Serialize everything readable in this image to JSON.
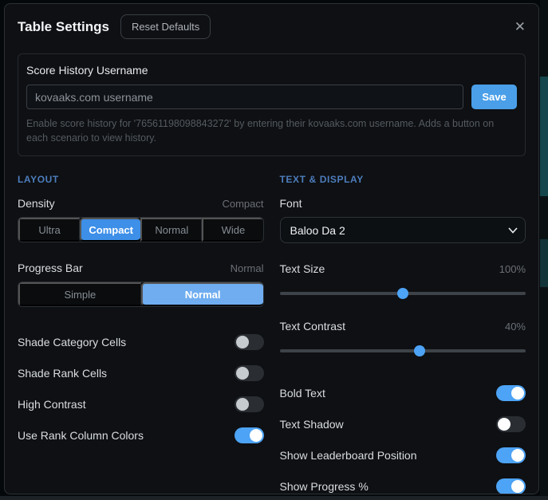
{
  "modal": {
    "title": "Table Settings",
    "reset_button_label": "Reset Defaults",
    "close_icon": "✕"
  },
  "score_history": {
    "label": "Score History Username",
    "input_value": "",
    "input_placeholder": "kovaaks.com username",
    "save_button_label": "Save",
    "help_text": "Enable score history for '76561198098843272' by entering their kovaaks.com username. Adds a button on each scenario to view history."
  },
  "layout_section": {
    "header": "LAYOUT",
    "density": {
      "label": "Density",
      "value": "Compact",
      "selected": "Compact",
      "options": [
        "Ultra",
        "Compact",
        "Normal",
        "Wide"
      ]
    },
    "progress_bar": {
      "label": "Progress Bar",
      "value": "Normal",
      "selected": "Normal",
      "options": [
        "Simple",
        "Normal"
      ]
    },
    "toggles": [
      {
        "label": "Shade Category Cells",
        "state": false
      },
      {
        "label": "Shade Rank Cells",
        "state": false
      },
      {
        "label": "High Contrast",
        "state": false
      },
      {
        "label": "Use Rank Column Colors",
        "state": true
      }
    ]
  },
  "text_display_section": {
    "header": "TEXT & DISPLAY",
    "font": {
      "label": "Font",
      "selected_value": "Baloo Da 2"
    },
    "text_size": {
      "label": "Text Size",
      "value": "100%",
      "slider_percent": 50
    },
    "text_contrast": {
      "label": "Text Contrast",
      "value": "40%",
      "slider_percent": 57
    },
    "toggles": [
      {
        "label": "Bold Text",
        "state": true
      },
      {
        "label": "Text Shadow",
        "state": false
      },
      {
        "label": "Show Leaderboard Position",
        "state": true
      },
      {
        "label": "Show Progress %",
        "state": true
      }
    ]
  },
  "colors": {
    "accent_blue": "#3d8fe8",
    "accent_blue_light": "#6fadf0",
    "toggle_on": "#4da3f5",
    "section_header_blue": "#4d7dbd",
    "modal_background": "#0e1013"
  }
}
